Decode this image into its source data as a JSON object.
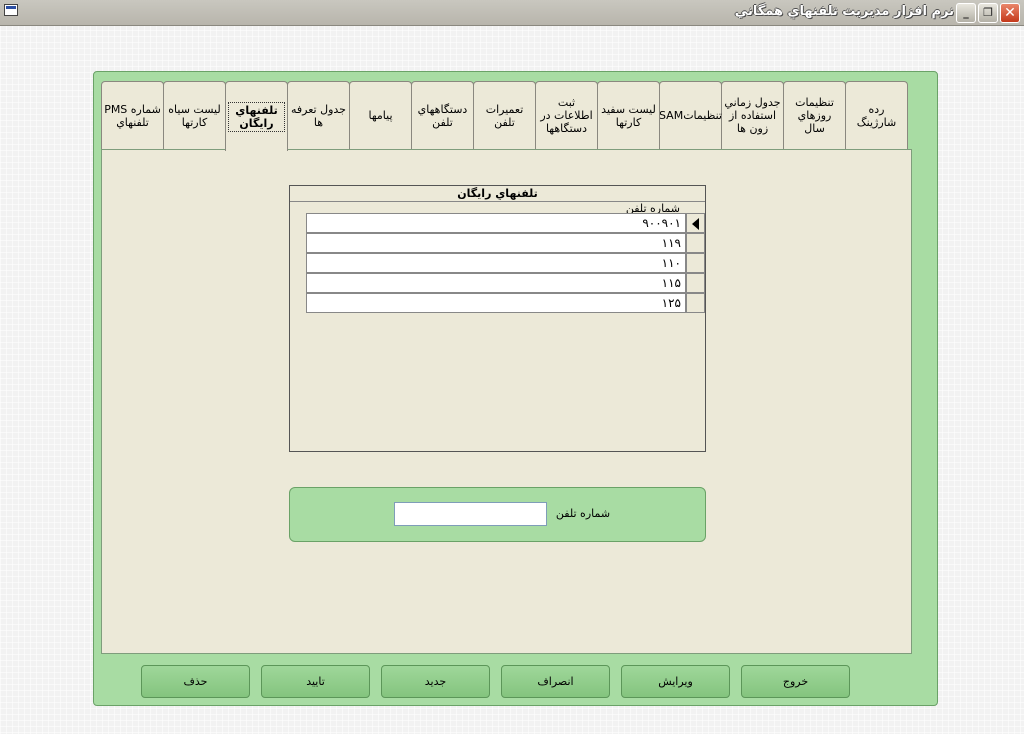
{
  "window": {
    "title": "نرم افزار مديريت تلفنهاي همگاني",
    "controls": {
      "minimize": "_",
      "restore": "❐",
      "close": "✕"
    }
  },
  "tabs": [
    {
      "label": "رده شارژينگ"
    },
    {
      "label": "تنظيمات روزهاي سال"
    },
    {
      "label": "جدول زماني استفاده از زون ها"
    },
    {
      "label": "تنظيماتSAM"
    },
    {
      "label": "ليست سفيد کارتها"
    },
    {
      "label": "ثبت اطلاعات در دستگاهها"
    },
    {
      "label": "تعميرات تلفن"
    },
    {
      "label": "دستگاههاي تلفن"
    },
    {
      "label": "پيامها"
    },
    {
      "label": "جدول تعرفه ها"
    },
    {
      "label": "تلفنهاي رايگان",
      "active": true
    },
    {
      "label": "ليست سياه کارتها"
    },
    {
      "label": "شماره PMS تلفنهاي"
    }
  ],
  "grid": {
    "caption": "تلفنهاي رايگان",
    "column_header": "شماره تلفن",
    "rows": [
      "۹۰۰۹۰۱",
      "۱۱۹",
      "۱۱۰",
      "۱۱۵",
      "۱۲۵"
    ],
    "selected_row": 0
  },
  "form": {
    "phone_label": "شماره تلفن",
    "phone_value": ""
  },
  "buttons": {
    "exit": "خروج",
    "edit": "ويرايش",
    "cancel": "انصراف",
    "new": "جديد",
    "confirm": "تاييد",
    "delete": "حذف"
  }
}
